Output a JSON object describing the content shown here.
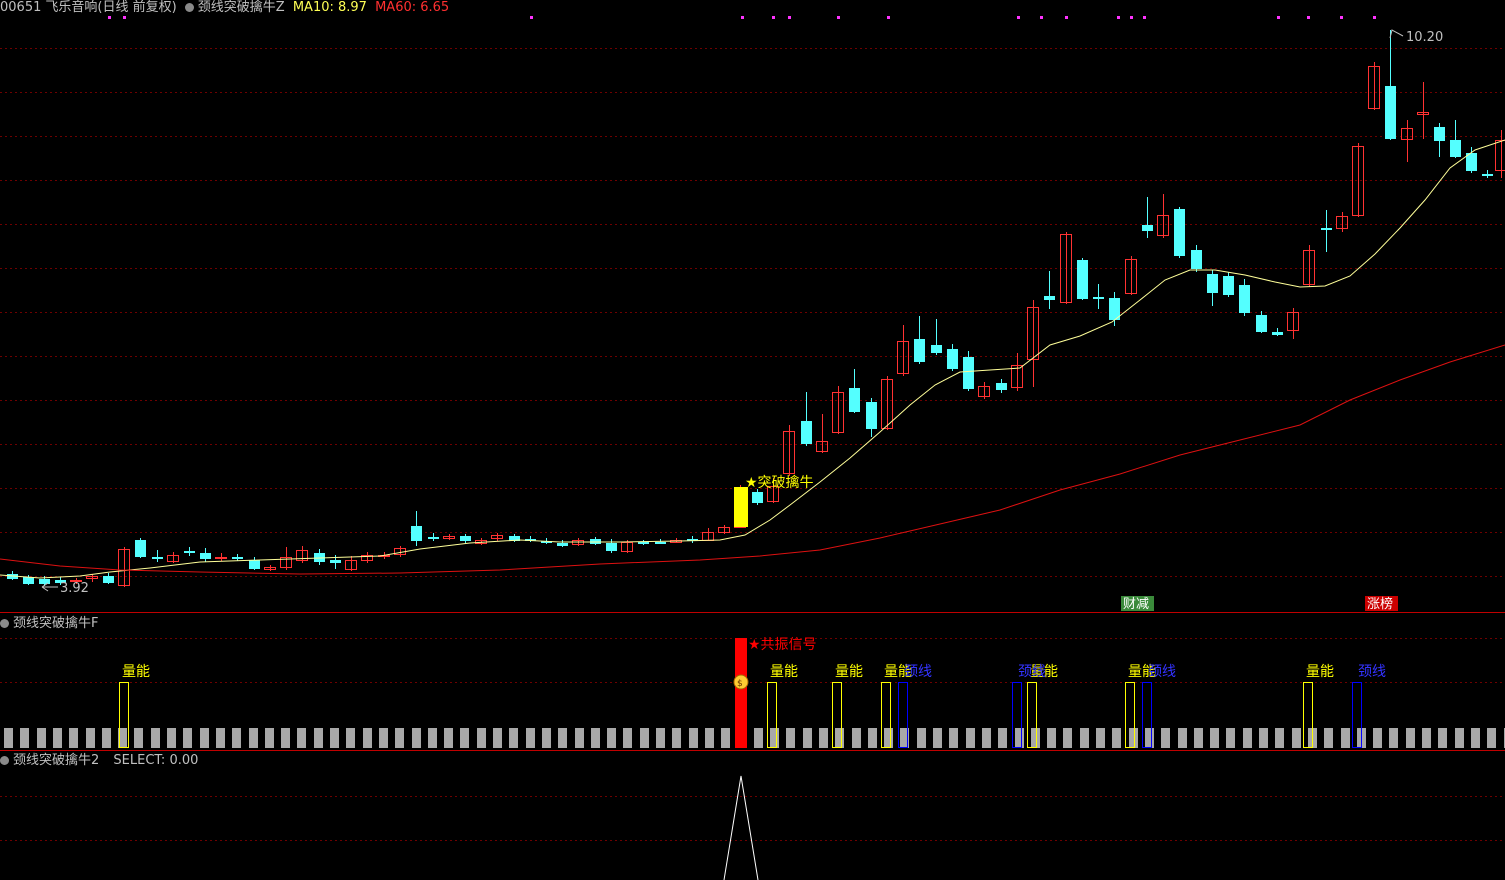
{
  "header": {
    "code": "00651",
    "name": "飞乐音响",
    "period": "(日线 前复权)",
    "formula": "颈线突破擒牛Z",
    "ma10_label": "MA10: 8.97",
    "ma60_label": "MA60: 6.65"
  },
  "colors": {
    "up": "#ff3232",
    "down": "#54ffff",
    "ma10": "#ffff99",
    "ma60": "#dd1111",
    "grid": "#6e0000",
    "signal_yellow": "#ffff00",
    "signal_red": "#ff0000",
    "neckline_blue": "#0000ff",
    "gray_bar": "#a8a8a8"
  },
  "main_chart": {
    "high_label": "10.20",
    "low_label": "3.92",
    "breakout_label": "★突破擒牛",
    "badges": [
      {
        "text": "财减",
        "bg": "#3a8a3a",
        "color": "#ffffff"
      },
      {
        "text": "涨榜",
        "bg": "#cc0000",
        "color": "#ffffff"
      }
    ]
  },
  "indicator1": {
    "title": "颈线突破擒牛F",
    "resonance_label": "★共振信号",
    "volume_label": "量能",
    "neckline_label": "颈线"
  },
  "indicator2": {
    "title": "颈线突破擒牛2",
    "select_label": "SELECT: 0.00"
  }
}
